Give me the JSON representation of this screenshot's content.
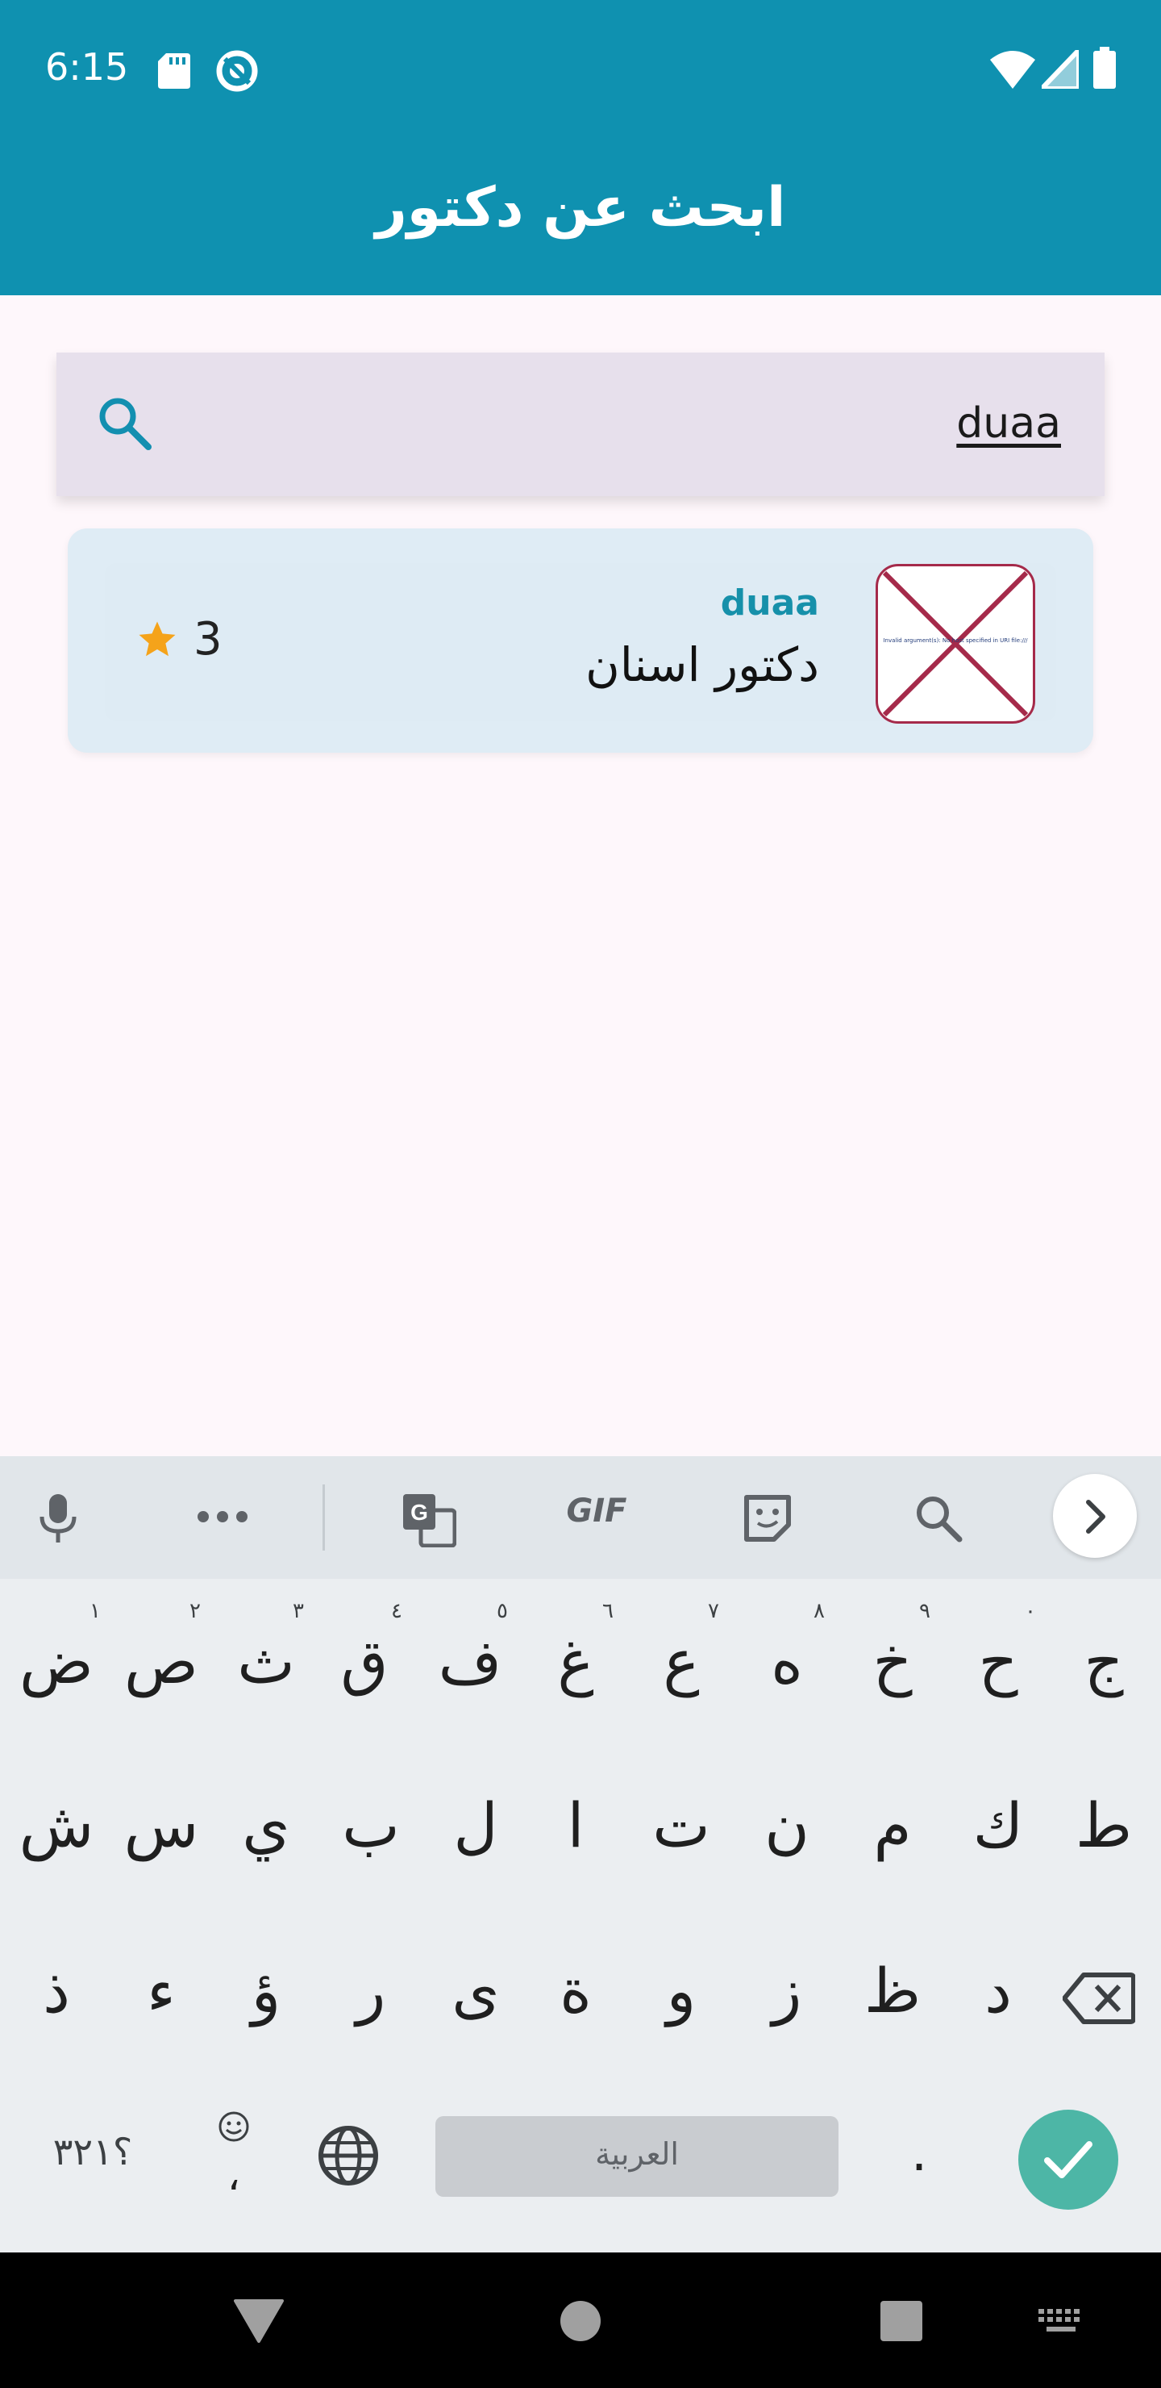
{
  "status_bar": {
    "time": "6:15",
    "left_icons": [
      "sd-card-icon",
      "data-saver-icon"
    ],
    "right_icons": [
      "wifi-icon",
      "cell-signal-icon",
      "battery-icon"
    ]
  },
  "app_bar": {
    "title": "ابحث عن دكتور"
  },
  "search": {
    "value": "duaa",
    "icon": "search-icon"
  },
  "results": [
    {
      "name": "duaa",
      "specialty": "دكتور اسنان",
      "rating": "3",
      "image_error_text": "Invalid argument(s): No host specified in URI file:///"
    }
  ],
  "keyboard": {
    "toolbar": {
      "gif_label": "GIF",
      "icons": [
        "mic-icon",
        "more-icon",
        "translate-icon",
        "gif-icon",
        "sticker-icon",
        "search-icon",
        "expand-icon"
      ]
    },
    "row1": [
      {
        "char": "ج",
        "hint": ""
      },
      {
        "char": "ح",
        "hint": "٠"
      },
      {
        "char": "خ",
        "hint": "٩"
      },
      {
        "char": "ه",
        "hint": "٨"
      },
      {
        "char": "ع",
        "hint": "٧"
      },
      {
        "char": "غ",
        "hint": "٦"
      },
      {
        "char": "ف",
        "hint": "٥"
      },
      {
        "char": "ق",
        "hint": "٤"
      },
      {
        "char": "ث",
        "hint": "٣"
      },
      {
        "char": "ص",
        "hint": "٢"
      },
      {
        "char": "ض",
        "hint": "١"
      }
    ],
    "row2": [
      "ط",
      "ك",
      "م",
      "ن",
      "ت",
      "ا",
      "ل",
      "ب",
      "ي",
      "س",
      "ش"
    ],
    "row3": [
      "د",
      "ظ",
      "ز",
      "و",
      "ة",
      "ى",
      "ر",
      "ؤ",
      "ء",
      "ذ"
    ],
    "bottom": {
      "numbers_label": "؟٣٢١",
      "comma": "،",
      "space_label": "العربية",
      "period": "."
    }
  },
  "colors": {
    "primary": "#0f91b0",
    "accent_teal": "#4db6a6",
    "star": "#f5a31a",
    "card_bg": "#dfecf5"
  }
}
